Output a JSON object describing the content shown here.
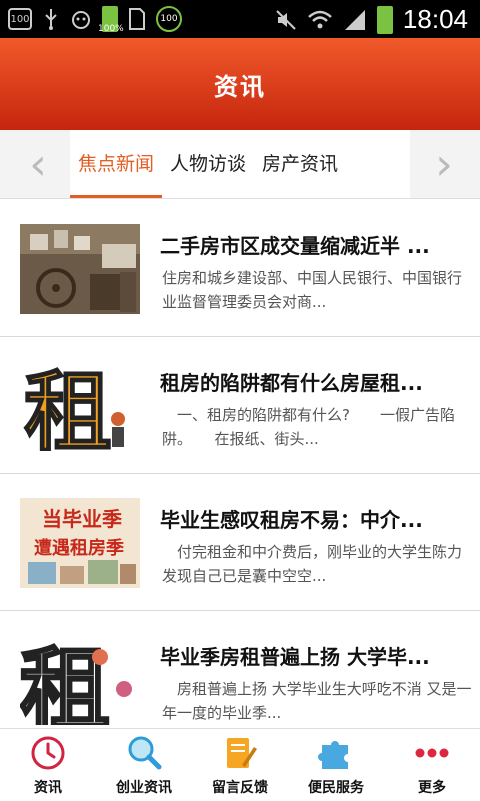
{
  "status_bar": {
    "left_icons": [
      "100",
      "usb-icon",
      "cat-icon",
      "battery-100-icon",
      "sim-icon",
      "100-circle-icon"
    ],
    "battery_small_label": "100%",
    "circle_label": "100",
    "box_label": "100",
    "time": "18:04"
  },
  "header": {
    "title": "资讯"
  },
  "tabs": [
    {
      "label": "焦点新闻",
      "active": true
    },
    {
      "label": "人物访谈",
      "active": false
    },
    {
      "label": "房产资讯",
      "active": false
    }
  ],
  "news": [
    {
      "title": "二手房市区成交量缩减近半 ...",
      "desc": "住房和城乡建设部、中国人民银行、中国银行业监督管理委员会对商..."
    },
    {
      "title": "租房的陷阱都有什么房屋租...",
      "desc": "　一、租房的陷阱都有什么?　　一假广告陷阱。　　在报纸、街头..."
    },
    {
      "title": "毕业生感叹租房不易：中介...",
      "desc": "　付完租金和中介费后，刚毕业的大学生陈力发现自己已是囊中空空..."
    },
    {
      "title": "毕业季房租普遍上扬 大学毕...",
      "desc": "　房租普遍上扬 大学毕业生大呼吃不消 又是一年一度的毕业季..."
    }
  ],
  "thumb_text": {
    "img2_char": "租",
    "img3_line1": "当毕业季",
    "img3_line2": "遭遇租房季",
    "img4_char": "租"
  },
  "bottom_nav": [
    {
      "label": "资讯",
      "icon": "clock-icon"
    },
    {
      "label": "创业资讯",
      "icon": "magnifier-icon"
    },
    {
      "label": "留言反馈",
      "icon": "pencil-note-icon"
    },
    {
      "label": "便民服务",
      "icon": "puzzle-icon"
    },
    {
      "label": "更多",
      "icon": "more-dots-icon"
    }
  ],
  "colors": {
    "header_top": "#f05a2a",
    "header_bottom": "#c6250e",
    "accent": "#e15f24"
  }
}
